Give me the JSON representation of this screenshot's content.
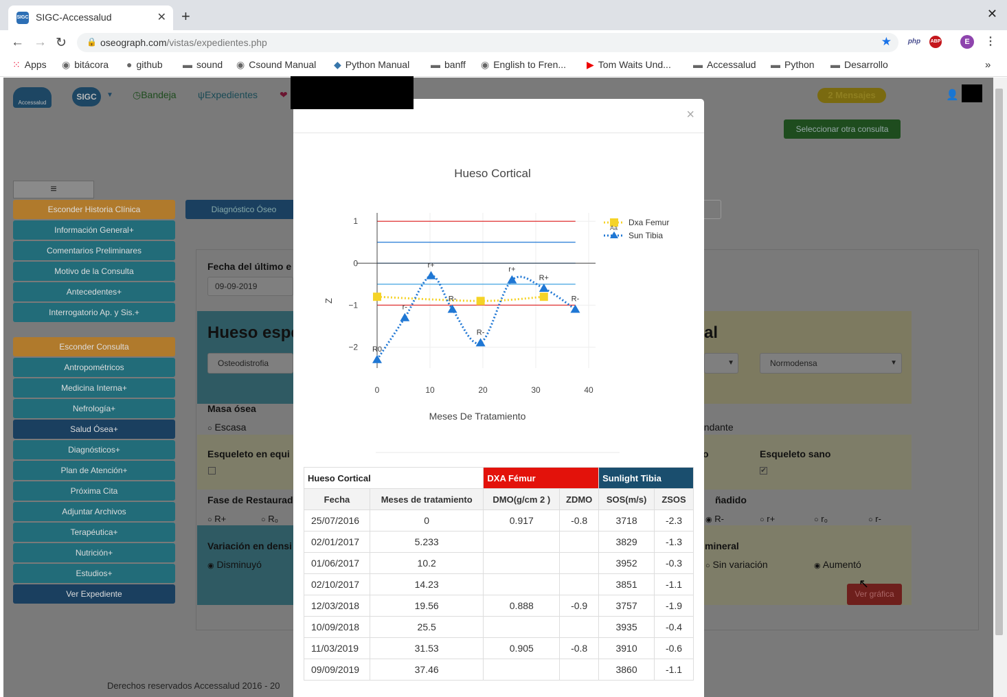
{
  "browser": {
    "tab_title": "SIGC-Accessalud",
    "url_domain": "oseograph.com",
    "url_path": "/vistas/expedientes.php",
    "favicon_text": "SIGC"
  },
  "bookmarks": [
    "Apps",
    "bitácora",
    "github",
    "sound",
    "Csound Manual",
    "Python Manual",
    "banff",
    "English to Fren...",
    "Tom Waits Und...",
    "Accessalud",
    "Python",
    "Desarrollo"
  ],
  "extensions": {
    "php": "php",
    "abp": "ABP",
    "profile": "E"
  },
  "nav": {
    "logo": "Accessalud",
    "sigc": "SIGC",
    "bandeja": "Bandeja",
    "expedientes": "Expedientes",
    "mensajes": "2 Mensajes"
  },
  "page": {
    "seleccionar": "Seleccionar otra consulta",
    "menu_icon": "≡",
    "sidebar": [
      "Esconder Historia Clínica",
      "Información General+",
      "Comentarios Preliminares",
      "Motivo de la Consulta",
      "Antecedentes+",
      "Interrogatorio Ap. y Sis.+",
      "Esconder Consulta",
      "Antropométricos",
      "Medicina Interna+",
      "Nefrología+",
      "Salud Ósea+",
      "Diagnósticos+",
      "Plan de Atención+",
      "Próxima Cita",
      "Adjuntar Archivos",
      "Terapéutica+",
      "Nutrición+",
      "Estudios+",
      "Ver Expediente"
    ],
    "diag_tab": "Diagnóstico Óseo",
    "fecha_label": "Fecha del último e",
    "fecha_value": "09-09-2019",
    "hueso_heading": "Hueso espe",
    "hueso_heading_right": "al",
    "osteo_select": "Osteodistrofia",
    "normodensa_select": "Normodensa",
    "masa_osea": "Masa ósea",
    "escasa": "Escasa",
    "abundante": "undante",
    "esqueleto_equi": "Esqueleto en equi",
    "esqueleto_sano": "Esqueleto sano",
    "fase": "Fase de Restaurad",
    "anadido": "ñadido",
    "r_plus": "R+",
    "r_zero": "R₀",
    "r_minus": "R-",
    "r_lower_plus": "r+",
    "r_lower_zero": "r₀",
    "r_lower_minus": "r-",
    "variacion": "Variación en densi",
    "mineral": "mineral",
    "disminuyo": "Disminuyó",
    "sin_variacion": "Sin variación",
    "aumento": "Aumentó",
    "ver_grafica": "Ver gráfica",
    "footer": "Derechos reservados Accessalud 2016 - 20"
  },
  "modal": {
    "close": "×"
  },
  "chart_data": {
    "type": "line",
    "title": "Hueso Cortical",
    "xlabel": "Meses De Tratamiento",
    "ylabel": "Z",
    "xlim": [
      0,
      40
    ],
    "ylim": [
      -2.5,
      1.2
    ],
    "xticks": [
      0,
      10,
      20,
      30,
      40
    ],
    "yticks": [
      1,
      0,
      -1,
      -2
    ],
    "ytick_labels": [
      "1",
      "0",
      "−1",
      "−2"
    ],
    "reference_lines": [
      {
        "y": 1,
        "color": "#e03030"
      },
      {
        "y": 0.5,
        "color": "#1f77d4"
      },
      {
        "y": 0,
        "color": "#1f77d4"
      },
      {
        "y": -0.5,
        "color": "#3fa2e0"
      },
      {
        "y": -1,
        "color": "#e03030"
      }
    ],
    "legend_position": "top-right",
    "series": [
      {
        "name": "Dxa Femur",
        "color": "#f5d327",
        "marker": "square",
        "x": [
          0,
          19.56,
          31.53
        ],
        "y": [
          -0.8,
          -0.9,
          -0.8
        ]
      },
      {
        "name": "Sun Tibia",
        "color": "#1f77d4",
        "marker": "triangle",
        "x": [
          0,
          5.233,
          10.2,
          14.23,
          19.56,
          25.5,
          31.53,
          37.46
        ],
        "y": [
          -2.3,
          -1.3,
          -0.3,
          -1.1,
          -1.9,
          -0.4,
          -0.6,
          -1.1
        ],
        "labels": [
          "R0",
          "r-",
          "r+",
          "R-",
          "R-",
          "r+",
          "R+",
          "R-"
        ]
      }
    ],
    "legend_extra": "Aa"
  },
  "table": {
    "group_headers": [
      "Hueso Cortical",
      "DXA Fémur",
      "Sunlight Tibia"
    ],
    "columns": [
      "Fecha",
      "Meses de tratamiento",
      "DMO(g/cm 2 )",
      "ZDMO",
      "SOS(m/s)",
      "ZSOS"
    ],
    "rows": [
      [
        "25/07/2016",
        "0",
        "0.917",
        "-0.8",
        "3718",
        "-2.3"
      ],
      [
        "02/01/2017",
        "5.233",
        "",
        "",
        "3829",
        "-1.3"
      ],
      [
        "01/06/2017",
        "10.2",
        "",
        "",
        "3952",
        "-0.3"
      ],
      [
        "02/10/2017",
        "14.23",
        "",
        "",
        "3851",
        "-1.1"
      ],
      [
        "12/03/2018",
        "19.56",
        "0.888",
        "-0.9",
        "3757",
        "-1.9"
      ],
      [
        "10/09/2018",
        "25.5",
        "",
        "",
        "3935",
        "-0.4"
      ],
      [
        "11/03/2019",
        "31.53",
        "0.905",
        "-0.8",
        "3910",
        "-0.6"
      ],
      [
        "09/09/2019",
        "37.46",
        "",
        "",
        "3860",
        "-1.1"
      ]
    ]
  }
}
